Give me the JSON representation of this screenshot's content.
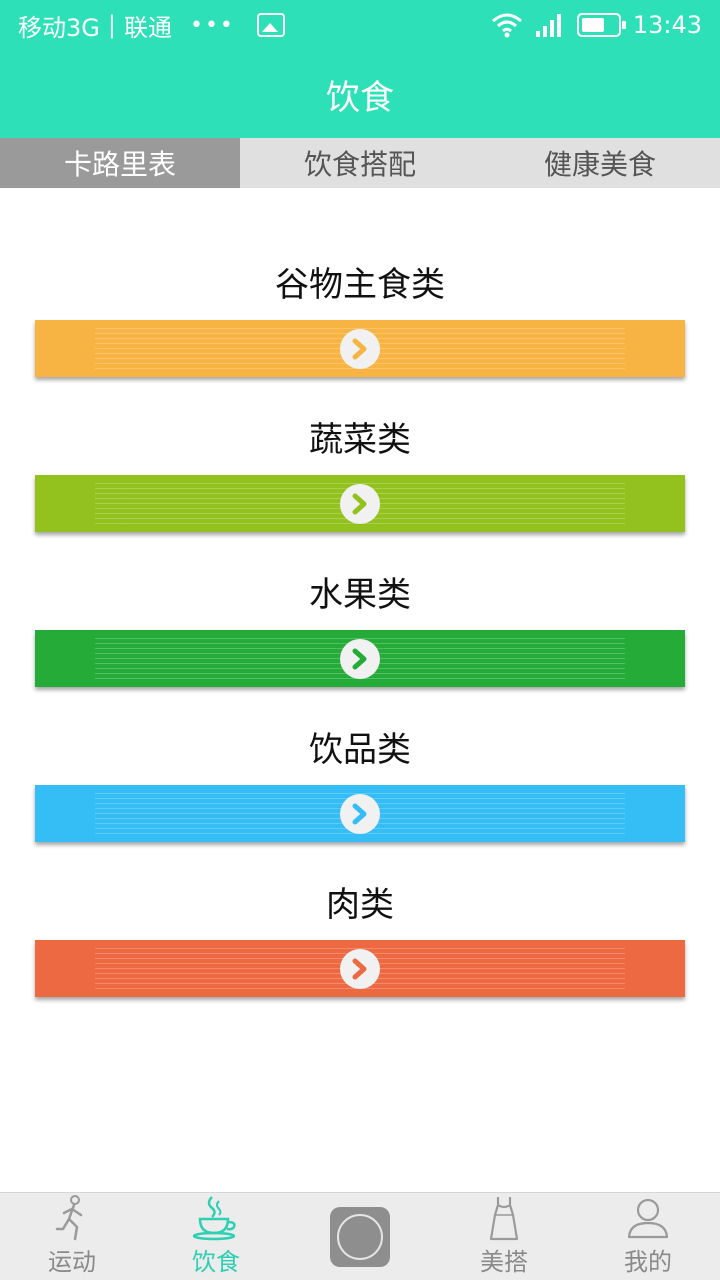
{
  "status_bar": {
    "carrier": "移动3G",
    "carrier2": "联通",
    "dots": "•••",
    "time": "13:43"
  },
  "header": {
    "title": "饮食"
  },
  "tabs": [
    {
      "label": "卡路里表",
      "active": true
    },
    {
      "label": "饮食搭配",
      "active": false
    },
    {
      "label": "健康美食",
      "active": false
    }
  ],
  "categories": [
    {
      "title": "谷物主食类",
      "color": "#f8b443"
    },
    {
      "title": "蔬菜类",
      "color": "#93c11d"
    },
    {
      "title": "水果类",
      "color": "#25ab38"
    },
    {
      "title": "饮品类",
      "color": "#35bdf5"
    },
    {
      "title": "肉类",
      "color": "#ec6941"
    }
  ],
  "bottom_nav": [
    {
      "label": "运动",
      "icon": "runner-icon",
      "active": false
    },
    {
      "label": "饮食",
      "icon": "coffee-cup-icon",
      "active": true
    },
    {
      "label": "",
      "icon": "app-logo-icon",
      "active": false
    },
    {
      "label": "美搭",
      "icon": "dress-icon",
      "active": false
    },
    {
      "label": "我的",
      "icon": "person-icon",
      "active": false
    }
  ],
  "colors": {
    "accent": "#2ee0b8",
    "nav_active": "#2ecfb2"
  }
}
